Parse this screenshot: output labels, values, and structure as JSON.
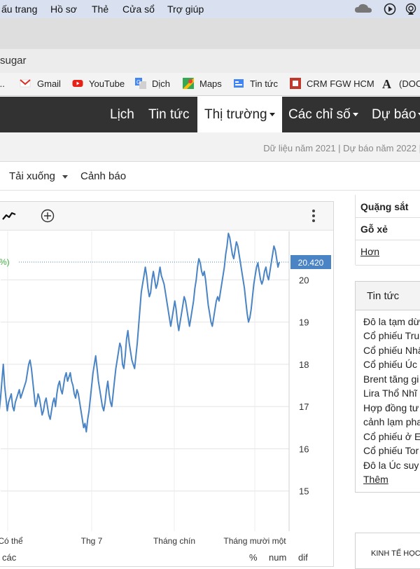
{
  "menubar": {
    "items": [
      "ấu trang",
      "Hồ sơ",
      "Thẻ",
      "Cửa sổ",
      "Trợ giúp"
    ]
  },
  "browser": {
    "url_text": "sugar",
    "bookmarks": [
      {
        "label": "...",
        "icon": "ellipsis"
      },
      {
        "label": "Gmail",
        "icon": "gmail-icon"
      },
      {
        "label": "YouTube",
        "icon": "youtube-icon"
      },
      {
        "label": "Dịch",
        "icon": "translate-icon"
      },
      {
        "label": "Maps",
        "icon": "maps-icon"
      },
      {
        "label": "Tin tức",
        "icon": "news-icon"
      },
      {
        "label": "CRM FGW HCM",
        "icon": "crm-icon"
      },
      {
        "label": "(DOC",
        "icon": "font-a-icon"
      }
    ]
  },
  "site_nav": {
    "items": [
      {
        "label": "Lịch",
        "dropdown": false
      },
      {
        "label": "Tin tức",
        "dropdown": false
      },
      {
        "label": "Thị trường",
        "dropdown": true,
        "active": true
      },
      {
        "label": "Các chỉ số",
        "dropdown": true
      },
      {
        "label": "Dự báo",
        "dropdown": true
      }
    ]
  },
  "subbar": {
    "note": "Dữ liệu năm 2021 | Dự báo năm 2022 |"
  },
  "toolbar": {
    "download": "Tải xuống",
    "alert": "Cảnh báo"
  },
  "chart": {
    "left_partial_label": "%)",
    "current_value_label": "20.420",
    "more_icon": "kebab-icon",
    "line_icon": "line-chart-icon",
    "add_icon": "plus-circle-icon",
    "line_color": "#4a84c4",
    "badge_color": "#4a84c4",
    "bottom_labels": [
      "các",
      "%",
      "num",
      "dif"
    ]
  },
  "chart_data": {
    "type": "line",
    "x_ticks": [
      "Có thể",
      "Thg 7",
      "Tháng chín",
      "Tháng mười một"
    ],
    "y_ticks": [
      15,
      16,
      17,
      18,
      19,
      20
    ],
    "ylim": [
      14.05,
      21.15
    ],
    "grid": true,
    "last_value": 20.42,
    "values": [
      17.1,
      16.9,
      17.2,
      17.6,
      18.0,
      17.5,
      17.2,
      16.9,
      17.1,
      17.2,
      17.3,
      17.0,
      16.9,
      17.1,
      17.2,
      17.3,
      17.4,
      17.2,
      17.3,
      17.4,
      17.5,
      17.6,
      17.8,
      18.0,
      18.1,
      17.9,
      17.6,
      17.3,
      17.0,
      17.1,
      17.3,
      17.2,
      17.0,
      16.8,
      16.9,
      17.1,
      17.2,
      17.0,
      16.8,
      16.7,
      16.9,
      17.1,
      17.2,
      17.0,
      17.3,
      17.5,
      17.6,
      17.4,
      17.3,
      17.5,
      17.7,
      17.8,
      17.6,
      17.7,
      17.8,
      17.6,
      17.5,
      17.3,
      17.2,
      17.4,
      17.3,
      17.1,
      16.9,
      16.7,
      16.5,
      16.6,
      16.4,
      16.7,
      16.9,
      17.2,
      17.5,
      17.8,
      18.0,
      18.2,
      17.9,
      17.6,
      17.4,
      17.2,
      17.0,
      16.9,
      17.1,
      17.4,
      17.6,
      17.3,
      17.1,
      17.0,
      17.3,
      17.6,
      17.9,
      18.1,
      18.3,
      18.5,
      18.4,
      18.0,
      17.9,
      18.2,
      18.6,
      18.8,
      18.5,
      18.3,
      18.1,
      18.0,
      17.9,
      18.2,
      18.5,
      18.9,
      19.3,
      19.7,
      19.9,
      20.1,
      20.3,
      20.1,
      19.8,
      19.6,
      19.7,
      20.0,
      20.2,
      20.0,
      19.8,
      19.9,
      20.1,
      20.3,
      20.1,
      20.0,
      19.9,
      19.7,
      19.5,
      19.3,
      19.1,
      18.9,
      19.1,
      19.3,
      19.5,
      19.3,
      19.0,
      18.8,
      19.0,
      19.2,
      19.4,
      19.6,
      19.5,
      19.3,
      19.1,
      18.9,
      19.1,
      19.3,
      19.5,
      19.8,
      20.0,
      20.3,
      20.5,
      20.4,
      20.2,
      20.1,
      20.2,
      20.0,
      19.7,
      19.4,
      19.2,
      19.0,
      18.9,
      19.1,
      19.3,
      19.5,
      19.6,
      19.5,
      19.7,
      19.9,
      20.1,
      20.3,
      20.6,
      20.8,
      21.1,
      21.0,
      20.8,
      20.6,
      20.5,
      20.7,
      20.9,
      20.8,
      20.6,
      20.4,
      20.2,
      20.0,
      19.8,
      19.5,
      19.2,
      19.0,
      19.1,
      19.3,
      19.6,
      19.9,
      20.1,
      20.3,
      20.4,
      20.2,
      20.0,
      19.9,
      20.0,
      20.2,
      20.3,
      20.1,
      20.0,
      20.2,
      20.4,
      20.6,
      20.8,
      20.7,
      20.5,
      20.3,
      20.42
    ]
  },
  "right_table": {
    "rows": [
      "Quặng sắt",
      "Gỗ xẻ",
      "Hơn"
    ]
  },
  "news": {
    "title": "Tin tức",
    "items": [
      "Đô la tạm dừ",
      "Cổ phiếu Tru",
      "Cổ phiếu Nhậ",
      "Cổ phiếu Úc",
      "Brent tăng gi",
      "Lira Thổ Nhĩ",
      "Hợp đồng tư",
      "cảnh lạm pha",
      "Cổ phiếu ở E",
      "Cổ phiếu Tor",
      "Đô la Úc suy"
    ],
    "more": "Thêm"
  },
  "econ_panel": {
    "title": "KINH TẾ HỌC"
  }
}
